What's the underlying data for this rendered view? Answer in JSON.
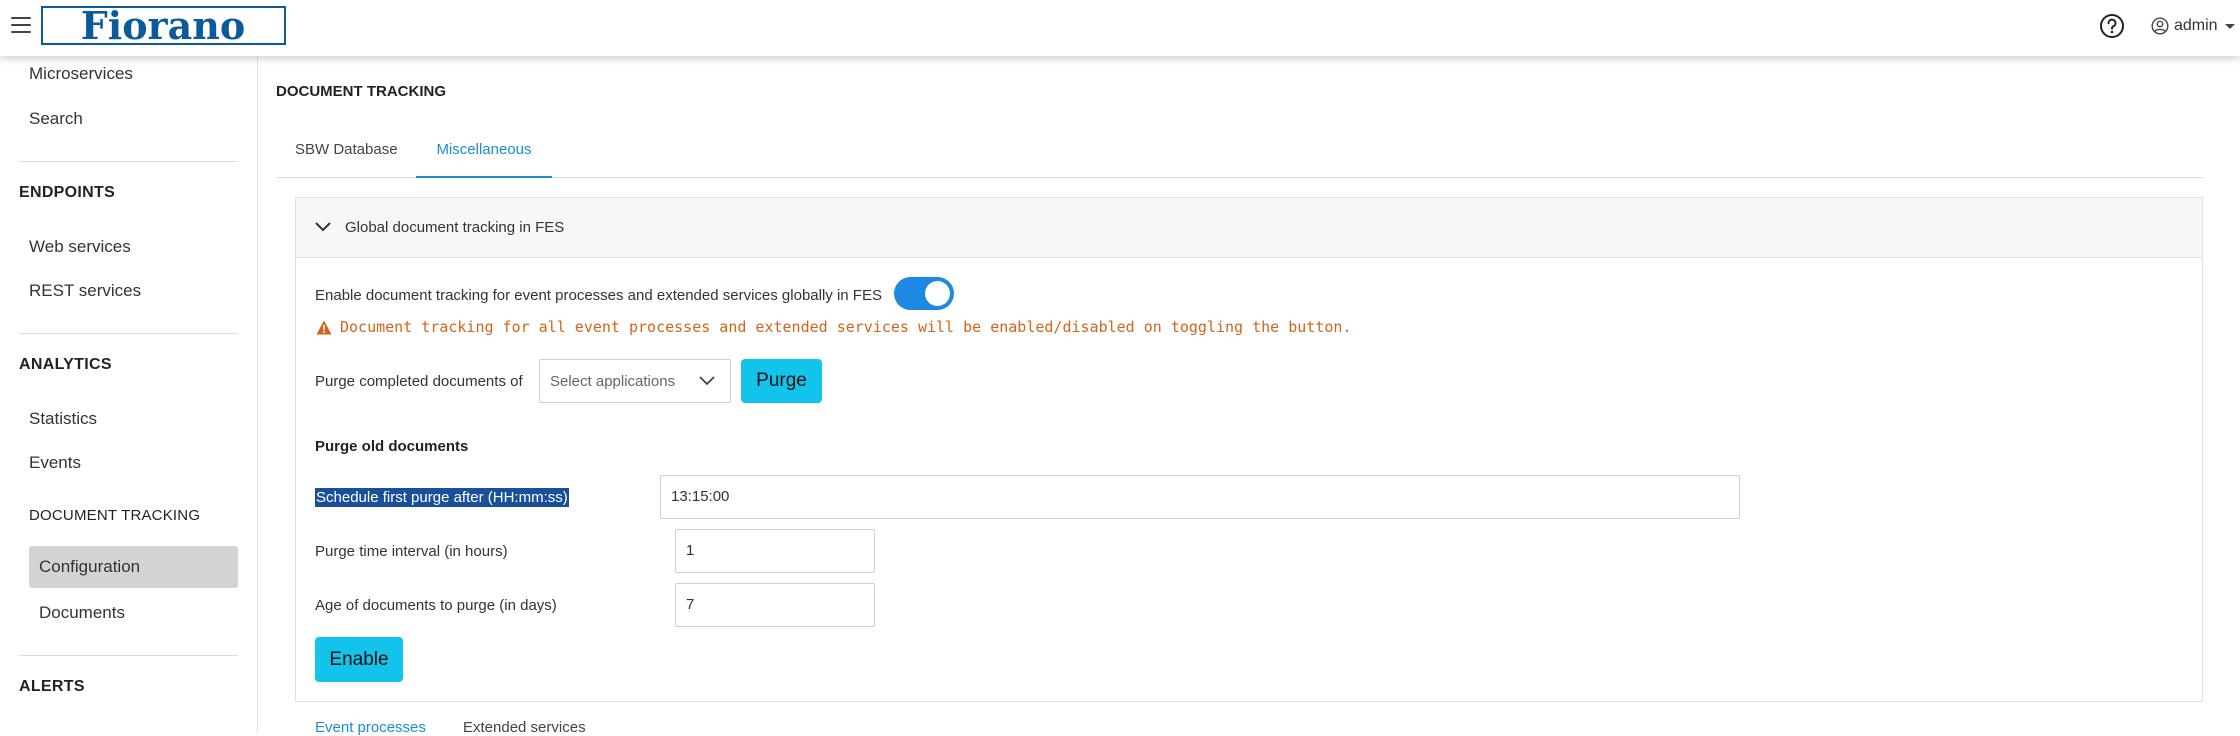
{
  "header": {
    "logo_text": "Fiorano",
    "user_label": "admin"
  },
  "sidebar": {
    "microservices": "Microservices",
    "search": "Search",
    "endpoints_title": "ENDPOINTS",
    "web_services": "Web services",
    "rest_services": "REST services",
    "analytics_title": "ANALYTICS",
    "statistics": "Statistics",
    "events": "Events",
    "doc_tracking_title": "DOCUMENT TRACKING",
    "configuration": "Configuration",
    "documents": "Documents",
    "alerts_title": "ALERTS"
  },
  "main": {
    "page_title": "DOCUMENT TRACKING",
    "tabs": [
      {
        "label": "SBW Database"
      },
      {
        "label": "Miscellaneous"
      }
    ],
    "panel": {
      "title": "Global document tracking in FES",
      "enable_label": "Enable document tracking for event processes and extended services globally in FES",
      "toggle_on": true,
      "warning": "Document tracking for all event processes and extended services will be enabled/disabled on toggling the button.",
      "purge_label": "Purge completed documents of",
      "select_placeholder": "Select applications",
      "purge_button": "Purge",
      "section_title": "Purge old documents",
      "schedule_label": "Schedule first purge after (HH:mm:ss)",
      "schedule_value": "13:15:00",
      "interval_label": "Purge time interval (in hours)",
      "interval_value": "1",
      "age_label": "Age of documents to purge (in days)",
      "age_value": "7",
      "enable_button": "Enable"
    },
    "subtabs": [
      {
        "label": "Event processes"
      },
      {
        "label": "Extended services"
      }
    ]
  },
  "colors": {
    "accent": "#1a8fd1",
    "button": "#12c3ec",
    "toggle": "#1e88e5",
    "warning": "#d3651a",
    "logo": "#0d5a9a"
  }
}
